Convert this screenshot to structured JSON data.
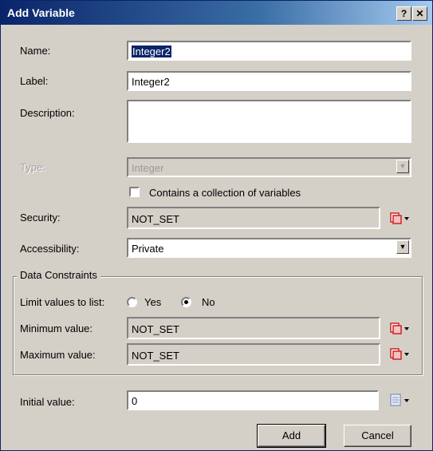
{
  "window": {
    "title": "Add Variable",
    "help_glyph": "?",
    "close_glyph": "✕"
  },
  "form": {
    "name_label": "Name:",
    "name_value": "Integer2",
    "label_label": "Label:",
    "label_value": "Integer2",
    "description_label": "Description:",
    "description_value": "",
    "type_label": "Type:",
    "type_value": "Integer",
    "collection_checkbox_label": "Contains a collection of variables",
    "collection_checked": false,
    "security_label": "Security:",
    "security_value": "NOT_SET",
    "accessibility_label": "Accessibility:",
    "accessibility_value": "Private"
  },
  "data_constraints": {
    "group_title": "Data Constraints",
    "limit_label": "Limit values to list:",
    "yes_label": "Yes",
    "no_label": "No",
    "selected": "No",
    "minimum_label": "Minimum value:",
    "minimum_value": "NOT_SET",
    "maximum_label": "Maximum value:",
    "maximum_value": "NOT_SET"
  },
  "initial": {
    "label": "Initial value:",
    "value": "0"
  },
  "buttons": {
    "add": "Add",
    "cancel": "Cancel"
  },
  "icons": {
    "edit_security": "security-edit-icon",
    "edit_min": "security-edit-icon",
    "edit_max": "security-edit-icon",
    "initial_value": "document-icon"
  },
  "colors": {
    "title_bar": "#0a246a",
    "dialog_bg": "#d4d0c8",
    "icon_red": "#cc2222"
  }
}
